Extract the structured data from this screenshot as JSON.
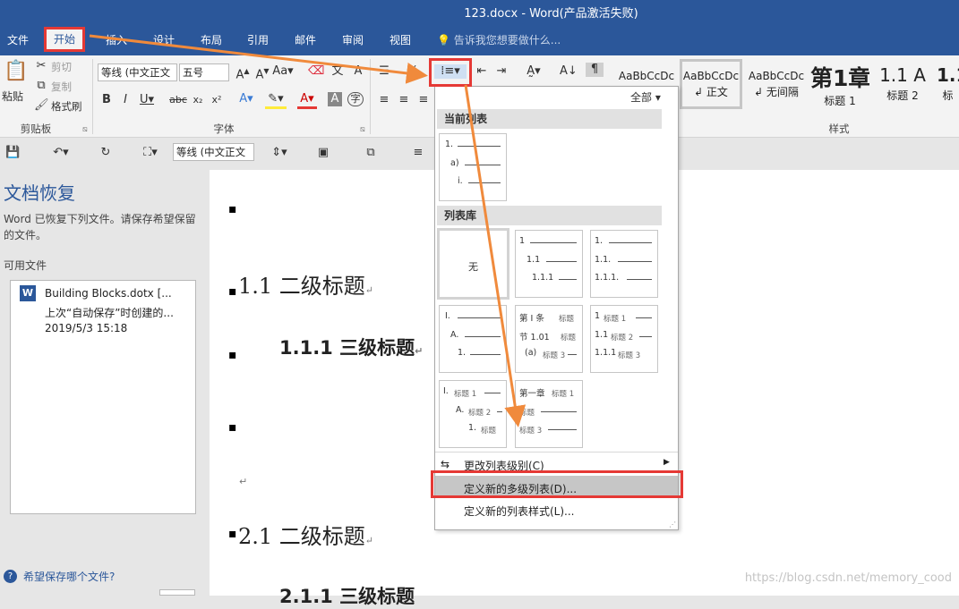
{
  "window": {
    "title": "123.docx - Word(产品激活失败)"
  },
  "tabs": [
    {
      "label": "文件"
    },
    {
      "label": "开始"
    },
    {
      "label": "插入"
    },
    {
      "label": "设计"
    },
    {
      "label": "布局"
    },
    {
      "label": "引用"
    },
    {
      "label": "邮件"
    },
    {
      "label": "审阅"
    },
    {
      "label": "视图"
    }
  ],
  "tell_me": "告诉我您想要做什么...",
  "clipboard": {
    "paste": "粘贴",
    "cut": "剪切",
    "copy": "复制",
    "format_painter": "格式刷",
    "label": "剪贴板"
  },
  "font": {
    "name": "等线 (中文正文",
    "size": "五号",
    "label": "字体"
  },
  "styles": {
    "label": "样式",
    "all_label": "全部",
    "items": [
      {
        "preview": "AaBbCcDc",
        "name": ""
      },
      {
        "preview": "AaBbCcDc",
        "name": "正文"
      },
      {
        "preview": "AaBbCcDc",
        "name": "无间隔"
      },
      {
        "preview": "第1章",
        "name": "标题 1"
      },
      {
        "preview": "1.1 A",
        "name": "标题 2"
      },
      {
        "preview": "1.1",
        "name": "标"
      }
    ]
  },
  "qat": {
    "font_name": "等线 (中文正文"
  },
  "recovery": {
    "title": "文档恢复",
    "description": "Word 已恢复下列文件。请保存希望保留的文件。",
    "available_label": "可用文件",
    "file": {
      "name": "Building Blocks.dotx  [...",
      "note": "上次“自动保存”时创建的...",
      "date": "2019/5/3 15:18"
    },
    "help_link": "希望保存哪个文件?"
  },
  "document": {
    "h2_1": "1.1 二级标题",
    "h3_1": "1.1.1 三级标题",
    "h2_2": "2.1 二级标题",
    "h3_2": "2.1.1 三级标题",
    "para_mark": "↵"
  },
  "dropdown": {
    "current_list_label": "当前列表",
    "library_label": "列表库",
    "none_label": "无",
    "thumb_current": [
      "1.",
      "a)",
      "i."
    ],
    "thumb_lib1": [
      "1",
      "1.1",
      "1.1.1"
    ],
    "thumb_lib2": [
      "1.",
      "1.1.",
      "1.1.1."
    ],
    "thumb_lib3": [
      "I.",
      "A.",
      "1."
    ],
    "thumb_lib4": [
      "第 I 条",
      "标题",
      "节 1.01",
      "标题",
      "(a)",
      "标题 3"
    ],
    "thumb_lib5": [
      "1",
      "标题 1",
      "1.1",
      "标题 2",
      "1.1.1",
      "标题 3"
    ],
    "thumb_lib6": [
      "I.",
      "标题 1",
      "A.",
      "标题 2",
      "1.",
      "标题"
    ],
    "thumb_lib7": [
      "第一章",
      "标题 1",
      "标题",
      "标题 3"
    ],
    "change_level": "更改列表级别(C)",
    "define_new_list": "定义新的多级列表(D)...",
    "define_new_style": "定义新的列表样式(L)..."
  },
  "watermark": "https://blog.csdn.net/memory_cood",
  "colors": {
    "brand": "#2b579a",
    "highlight_red": "#e53935",
    "arrow_orange": "#f08a3c"
  }
}
